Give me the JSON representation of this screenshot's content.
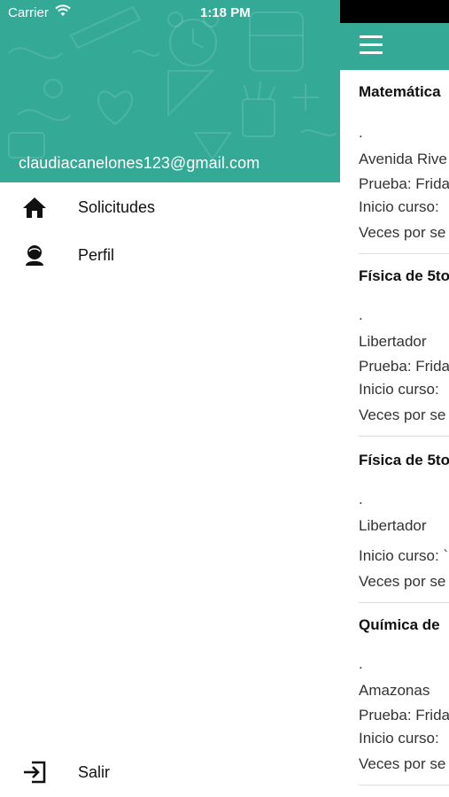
{
  "status_bar": {
    "carrier": "Carrier",
    "time": "1:18 PM"
  },
  "drawer": {
    "email": "claudiacanelones123@gmail.com",
    "menu": [
      {
        "label": "Solicitudes",
        "icon": "home-icon"
      },
      {
        "label": "Perfil",
        "icon": "user-icon"
      }
    ],
    "logout": {
      "label": "Salir",
      "icon": "logout-icon"
    }
  },
  "main": {
    "cards": [
      {
        "title": "Matemática",
        "dot": ".",
        "lines": [
          "Avenida Rive",
          "Prueba: Frida",
          "Inicio curso:",
          "Veces por se"
        ]
      },
      {
        "title": "Física de 5to",
        "dot": ".",
        "lines": [
          "Libertador",
          "Prueba: Frida",
          "Inicio curso:",
          "Veces por se"
        ]
      },
      {
        "title": "Física de 5to",
        "dot": ".",
        "lines": [
          "Libertador",
          "Inicio curso: `",
          "Veces por se"
        ]
      },
      {
        "title": "Química de",
        "dot": ".",
        "lines": [
          "Amazonas",
          "Prueba: Frida",
          "Inicio curso:",
          "Veces por se"
        ]
      }
    ]
  },
  "colors": {
    "accent": "#33a996",
    "status_black": "#000000"
  }
}
